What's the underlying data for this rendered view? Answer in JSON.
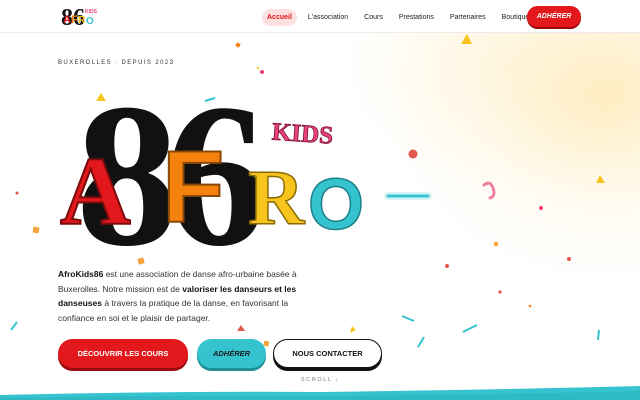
{
  "header": {
    "logo_text": "AfroKids86",
    "nav": [
      {
        "label": "Accueil",
        "active": true
      },
      {
        "label": "L'association",
        "active": false
      },
      {
        "label": "Cours",
        "active": false
      },
      {
        "label": "Prestations",
        "active": false
      },
      {
        "label": "Partenaires",
        "active": false
      },
      {
        "label": "Boutique",
        "active": false
      }
    ],
    "cta_label": "ADHÉRER"
  },
  "hero": {
    "eyebrow": "BUXEROLLES · DEPUIS 2023",
    "logo": {
      "number": "86",
      "word_letters": [
        "A",
        "F",
        "R",
        "O"
      ],
      "kids_text": "KIDS"
    },
    "description": {
      "brand": "AfroKids86",
      "part1": " est une association de danse afro-urbaine basée à Buxerolles. Notre mission est de ",
      "highlight": "valoriser les danseurs et les danseuses",
      "part2": " à travers la pratique de la danse, en favorisant la confiance en soi et le plaisir de partager."
    },
    "buttons": {
      "cours": "DÉCOUVRIR LES COURS",
      "adherer": "ADHÉRER",
      "contact": "NOUS CONTACTER"
    },
    "scroll_label": "SCROLL ↓"
  },
  "colors": {
    "red": "#e2181c",
    "orange": "#f5820d",
    "yellow": "#f7c51e",
    "cyan": "#35c4cf",
    "pink": "#e8447a",
    "black": "#111111"
  }
}
